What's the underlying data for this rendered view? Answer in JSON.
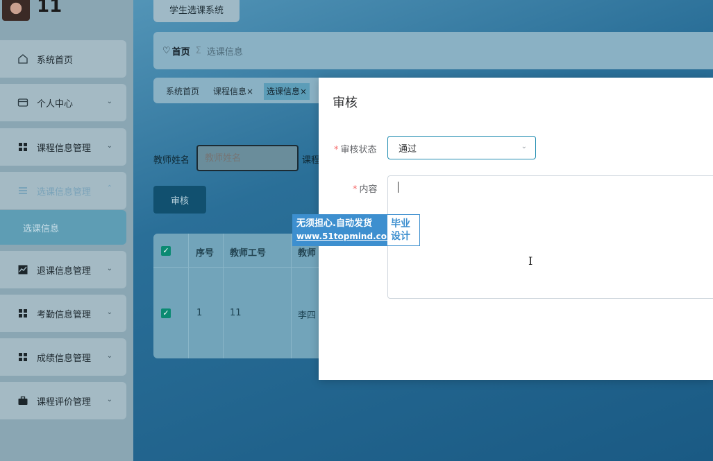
{
  "user": {
    "name": "11"
  },
  "system_tab": "学生选课系统",
  "sidebar": {
    "items": [
      {
        "label": "系统首页",
        "icon": "home-icon",
        "chevron": false
      },
      {
        "label": "个人中心",
        "icon": "card-icon",
        "chevron": true
      },
      {
        "label": "课程信息管理",
        "icon": "grid-icon",
        "chevron": true
      },
      {
        "label": "选课信息管理",
        "icon": "list-icon",
        "chevron": true,
        "expanded": true
      },
      {
        "label": "退课信息管理",
        "icon": "chart-icon",
        "chevron": true
      },
      {
        "label": "考勤信息管理",
        "icon": "grid-icon",
        "chevron": true
      },
      {
        "label": "成绩信息管理",
        "icon": "grid-icon",
        "chevron": true
      },
      {
        "label": "课程评价管理",
        "icon": "briefcase-icon",
        "chevron": true
      }
    ],
    "sub_item": "选课信息"
  },
  "breadcrumb": {
    "home": "首页",
    "separator": "Σ",
    "current": "选课信息"
  },
  "tags": [
    {
      "label": "系统首页",
      "closable": false
    },
    {
      "label": "课程信息",
      "closable": true
    },
    {
      "label": "选课信息",
      "closable": true,
      "active": true
    }
  ],
  "close_glyph": "×",
  "search": {
    "teacher_label": "教师姓名",
    "teacher_placeholder": "教师姓名",
    "course_label_partial": "课程"
  },
  "buttons": {
    "audit": "审核"
  },
  "table": {
    "headers": [
      "序号",
      "教师工号",
      "教师"
    ],
    "rows": [
      {
        "index": "1",
        "teacher_id": "11",
        "teacher_name": "李四"
      }
    ]
  },
  "dialog": {
    "title": "审核",
    "status_label": "审核状态",
    "status_value": "通过",
    "content_label": "内容",
    "required_mark": "*"
  },
  "watermark": {
    "line1": "无须担心.自动发货",
    "line2": "www.51topmind.com",
    "right1": "毕业",
    "right2": "设计"
  },
  "colors": {
    "accent": "#1e8bb0",
    "required": "#f56c6c",
    "watermark_blue": "#3d8fcf",
    "checkbox": "#0b8a72"
  }
}
